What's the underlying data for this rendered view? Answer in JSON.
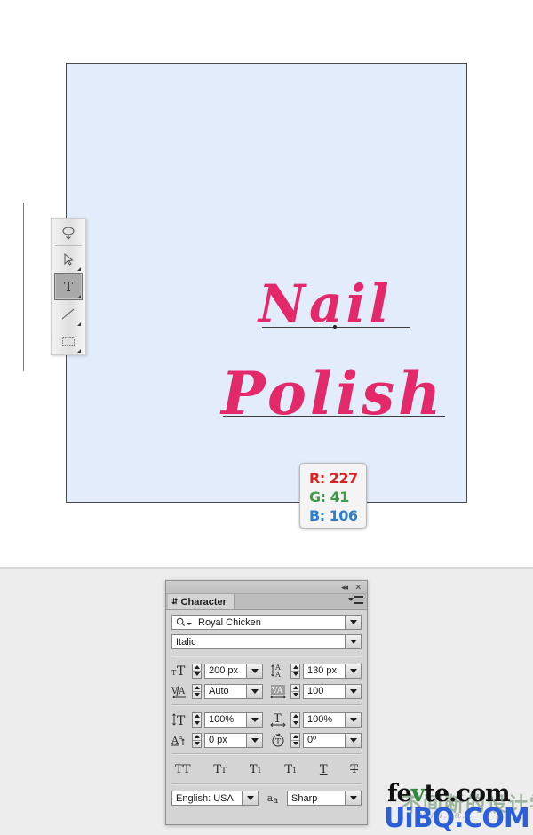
{
  "canvas": {
    "text_line_1": "Nail",
    "text_line_2": "Polish",
    "text_color": "#e3296a",
    "background_color": "#e2ecfb"
  },
  "color_readout": {
    "r_label": "R: 227",
    "g_label": "G: 41",
    "b_label": "B: 106",
    "r_color": "#e02020",
    "g_color": "#3f9a4a",
    "b_color": "#2f7fd0"
  },
  "toolbar": {
    "tools": [
      {
        "name": "rotate-view-tool",
        "selected": false
      },
      {
        "name": "direct-selection-tool",
        "selected": false
      },
      {
        "name": "type-tool",
        "label": "T",
        "selected": true
      },
      {
        "name": "line-tool",
        "selected": false
      },
      {
        "name": "rectangle-tool",
        "selected": false
      }
    ]
  },
  "character_panel": {
    "titlebar": {
      "collapse_label": "◂◂",
      "close_label": "✕"
    },
    "tab_label": "Character",
    "font_family": {
      "value": "Royal Chicken",
      "icon": "search-icon"
    },
    "font_style": {
      "value": "Italic"
    },
    "fields": {
      "font_size": {
        "icon": "font-size-icon",
        "value": "200 px"
      },
      "leading": {
        "icon": "leading-icon",
        "value": "130 px"
      },
      "kerning": {
        "icon": "kerning-icon",
        "value": "Auto"
      },
      "tracking": {
        "icon": "tracking-icon",
        "value": "100"
      },
      "vertical_scale": {
        "icon": "vertical-scale-icon",
        "value": "100%"
      },
      "horizontal_scale": {
        "icon": "horizontal-scale-icon",
        "value": "100%"
      },
      "baseline_shift": {
        "icon": "baseline-shift-icon",
        "value": "0 px"
      },
      "text_rotation": {
        "icon": "text-rotation-icon",
        "value": "0º"
      }
    },
    "style_buttons": [
      {
        "name": "all-caps-button",
        "label": "TT"
      },
      {
        "name": "small-caps-button",
        "label": "T"
      },
      {
        "name": "superscript-button",
        "label": "T"
      },
      {
        "name": "subscript-button",
        "label": "T"
      },
      {
        "name": "underline-button",
        "label": "T"
      },
      {
        "name": "strikethrough-button",
        "label": "T"
      }
    ],
    "language": {
      "value": "English: USA"
    },
    "anti_aliasing": {
      "value": "Sharp",
      "icon": "anti-alias-icon"
    }
  },
  "watermarks": {
    "fevte_pre": "fe",
    "fevte_v": "v",
    "fevte_post": "te.com",
    "uibq": "UiBQ.COM",
    "chinese": "不间断的设计学习",
    "sub": "www.sa.z"
  }
}
